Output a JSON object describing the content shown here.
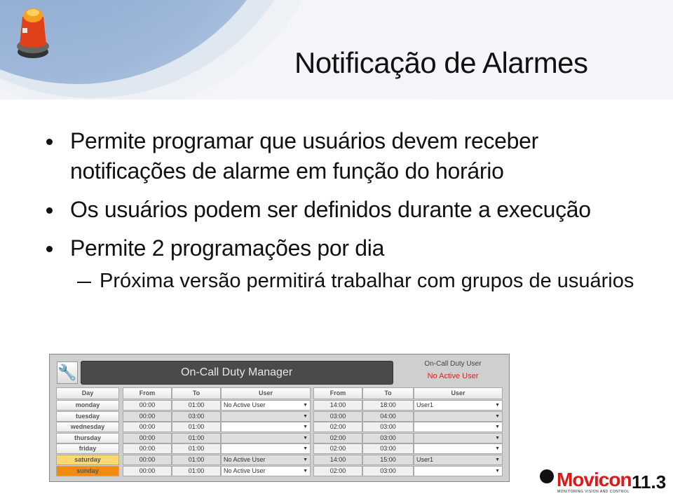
{
  "slide": {
    "title": "Notificação de Alarmes",
    "bullets": [
      {
        "text": "Permite programar que usuários devem receber notificações de alarme em função do horário"
      },
      {
        "text": "Os usuários podem ser definidos durante a execução"
      },
      {
        "text": "Permite 2 programações por dia",
        "sub": "Próxima versão permitirá trabalhar com grupos de usuários"
      }
    ]
  },
  "screenshot": {
    "title": "On-Call Duty Manager",
    "wrench_icon": "wrench-icon",
    "on_call_label": "On-Call Duty User",
    "on_call_value": "No Active User",
    "on_call_color": "#e02020",
    "headers": [
      "Day",
      "From",
      "To",
      "User",
      "From",
      "To",
      "User"
    ],
    "rows": [
      {
        "day": "monday",
        "from1": "00:00",
        "to1": "01:00",
        "user1": "No Active User",
        "from2": "14:00",
        "to2": "18:00",
        "user2": "User1"
      },
      {
        "day": "tuesday",
        "from1": "00:00",
        "to1": "03:00",
        "user1": "",
        "from2": "03:00",
        "to2": "04:00",
        "user2": ""
      },
      {
        "day": "wednesday",
        "from1": "00:00",
        "to1": "01:00",
        "user1": "",
        "from2": "02:00",
        "to2": "03:00",
        "user2": ""
      },
      {
        "day": "thursday",
        "from1": "00:00",
        "to1": "01:00",
        "user1": "",
        "from2": "02:00",
        "to2": "03:00",
        "user2": ""
      },
      {
        "day": "friday",
        "from1": "00:00",
        "to1": "01:00",
        "user1": "",
        "from2": "02:00",
        "to2": "03:00",
        "user2": ""
      },
      {
        "day": "saturday",
        "from1": "00:00",
        "to1": "01:00",
        "user1": "No Active User",
        "from2": "14:00",
        "to2": "15:00",
        "user2": "User1"
      },
      {
        "day": "sunday",
        "from1": "00:00",
        "to1": "01:00",
        "user1": "No Active User",
        "from2": "02:00",
        "to2": "03:00",
        "user2": ""
      }
    ],
    "day_colors": {
      "saturday": "#ffd870",
      "sunday": "#f28a10"
    }
  },
  "logo": {
    "name": "Movicon",
    "version": "11.3",
    "tagline": "MONITORING VISION AND CONTROL",
    "brand_color": "#e01818"
  }
}
